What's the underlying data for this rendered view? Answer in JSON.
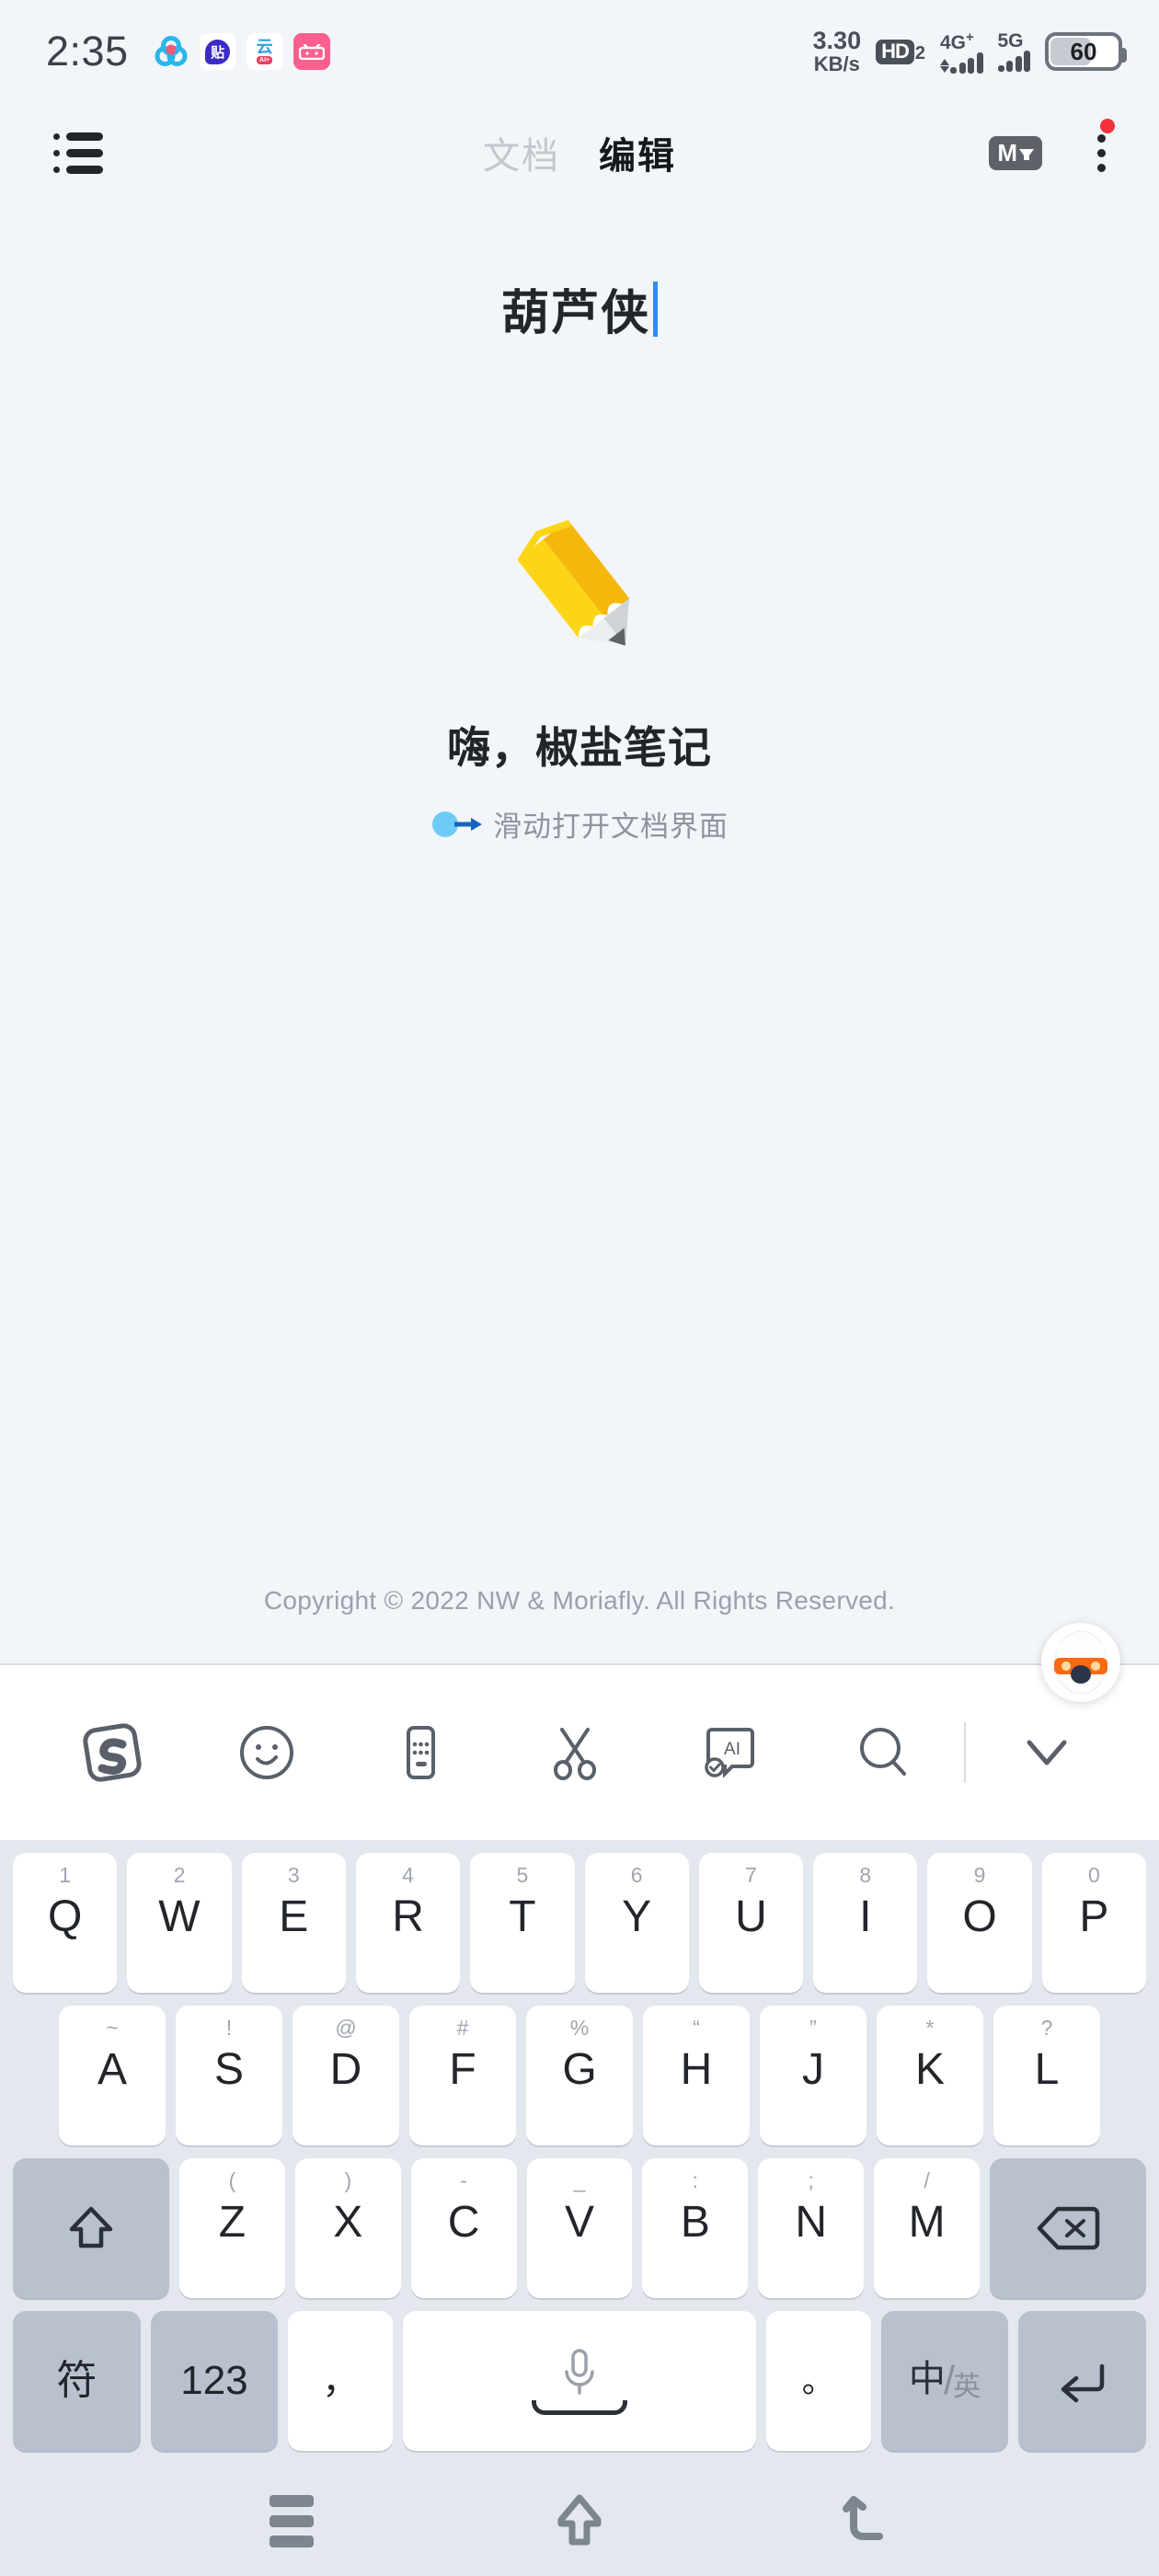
{
  "status_bar": {
    "clock": "2:35",
    "notification_icons": [
      {
        "name": "trefoil-app-icon",
        "label": ""
      },
      {
        "name": "tieba-app-icon",
        "label": "贴"
      },
      {
        "name": "cloud-ai-app-icon",
        "label": "云",
        "sub_label": "AI+"
      },
      {
        "name": "bilibili-app-icon",
        "label": "bilibili"
      }
    ],
    "network_speed_value": "3.30",
    "network_speed_unit": "KB/s",
    "hd_badge": "HD",
    "hd_sub": "2",
    "sim1_network": "4G",
    "sim1_plus": "+",
    "sim2_network": "5G",
    "battery_level": "60"
  },
  "header": {
    "list_icon": "list-icon",
    "tab_document": "文档",
    "tab_edit": "编辑",
    "markdown_badge": "M",
    "menu_icon": "kebab-menu-icon",
    "has_notification_dot": true
  },
  "document": {
    "title": "葫芦侠",
    "cursor_color": "#2a8cf0"
  },
  "empty_state": {
    "emoji": "pencil-emoji",
    "greeting": "嗨，椒盐笔记",
    "hint_icon": "swipe-right-icon",
    "hint_text": "滑动打开文档界面"
  },
  "footer": {
    "copyright": "Copyright © 2022 NW & Moriafly. All Rights Reserved."
  },
  "keyboard": {
    "toolbar": [
      {
        "name": "sogou-logo-icon",
        "label": "S"
      },
      {
        "name": "emoji-icon",
        "label": ""
      },
      {
        "name": "keyboard-settings-icon",
        "label": ""
      },
      {
        "name": "scissors-icon",
        "label": ""
      },
      {
        "name": "ai-card-icon",
        "label": "AI"
      },
      {
        "name": "search-icon",
        "label": ""
      },
      {
        "name": "collapse-keyboard-icon",
        "label": ""
      }
    ],
    "mascot": "sogou-fox-mascot",
    "row1": [
      {
        "sup": "1",
        "main": "Q"
      },
      {
        "sup": "2",
        "main": "W"
      },
      {
        "sup": "3",
        "main": "E"
      },
      {
        "sup": "4",
        "main": "R"
      },
      {
        "sup": "5",
        "main": "T"
      },
      {
        "sup": "6",
        "main": "Y"
      },
      {
        "sup": "7",
        "main": "U"
      },
      {
        "sup": "8",
        "main": "I"
      },
      {
        "sup": "9",
        "main": "O"
      },
      {
        "sup": "0",
        "main": "P"
      }
    ],
    "row2": [
      {
        "sup": "~",
        "main": "A"
      },
      {
        "sup": "!",
        "main": "S"
      },
      {
        "sup": "@",
        "main": "D"
      },
      {
        "sup": "#",
        "main": "F"
      },
      {
        "sup": "%",
        "main": "G"
      },
      {
        "sup": "“",
        "main": "H"
      },
      {
        "sup": "”",
        "main": "J"
      },
      {
        "sup": "*",
        "main": "K"
      },
      {
        "sup": "?",
        "main": "L"
      }
    ],
    "row3": [
      {
        "sup": "(",
        "main": "Z"
      },
      {
        "sup": ")",
        "main": "X"
      },
      {
        "sup": "-",
        "main": "C"
      },
      {
        "sup": "_",
        "main": "V"
      },
      {
        "sup": ":",
        "main": "B"
      },
      {
        "sup": ";",
        "main": "N"
      },
      {
        "sup": "/",
        "main": "M"
      }
    ],
    "shift_key": "shift-icon",
    "backspace_key": "backspace-icon",
    "row4": {
      "symbols": "符",
      "numbers": "123",
      "comma": "，",
      "space": "space-key",
      "period": "。",
      "lang_zh": "中",
      "lang_en": "英",
      "enter": "enter-icon"
    }
  },
  "nav_bar": {
    "recents": "recents-icon",
    "home": "home-icon",
    "back": "back-icon"
  }
}
